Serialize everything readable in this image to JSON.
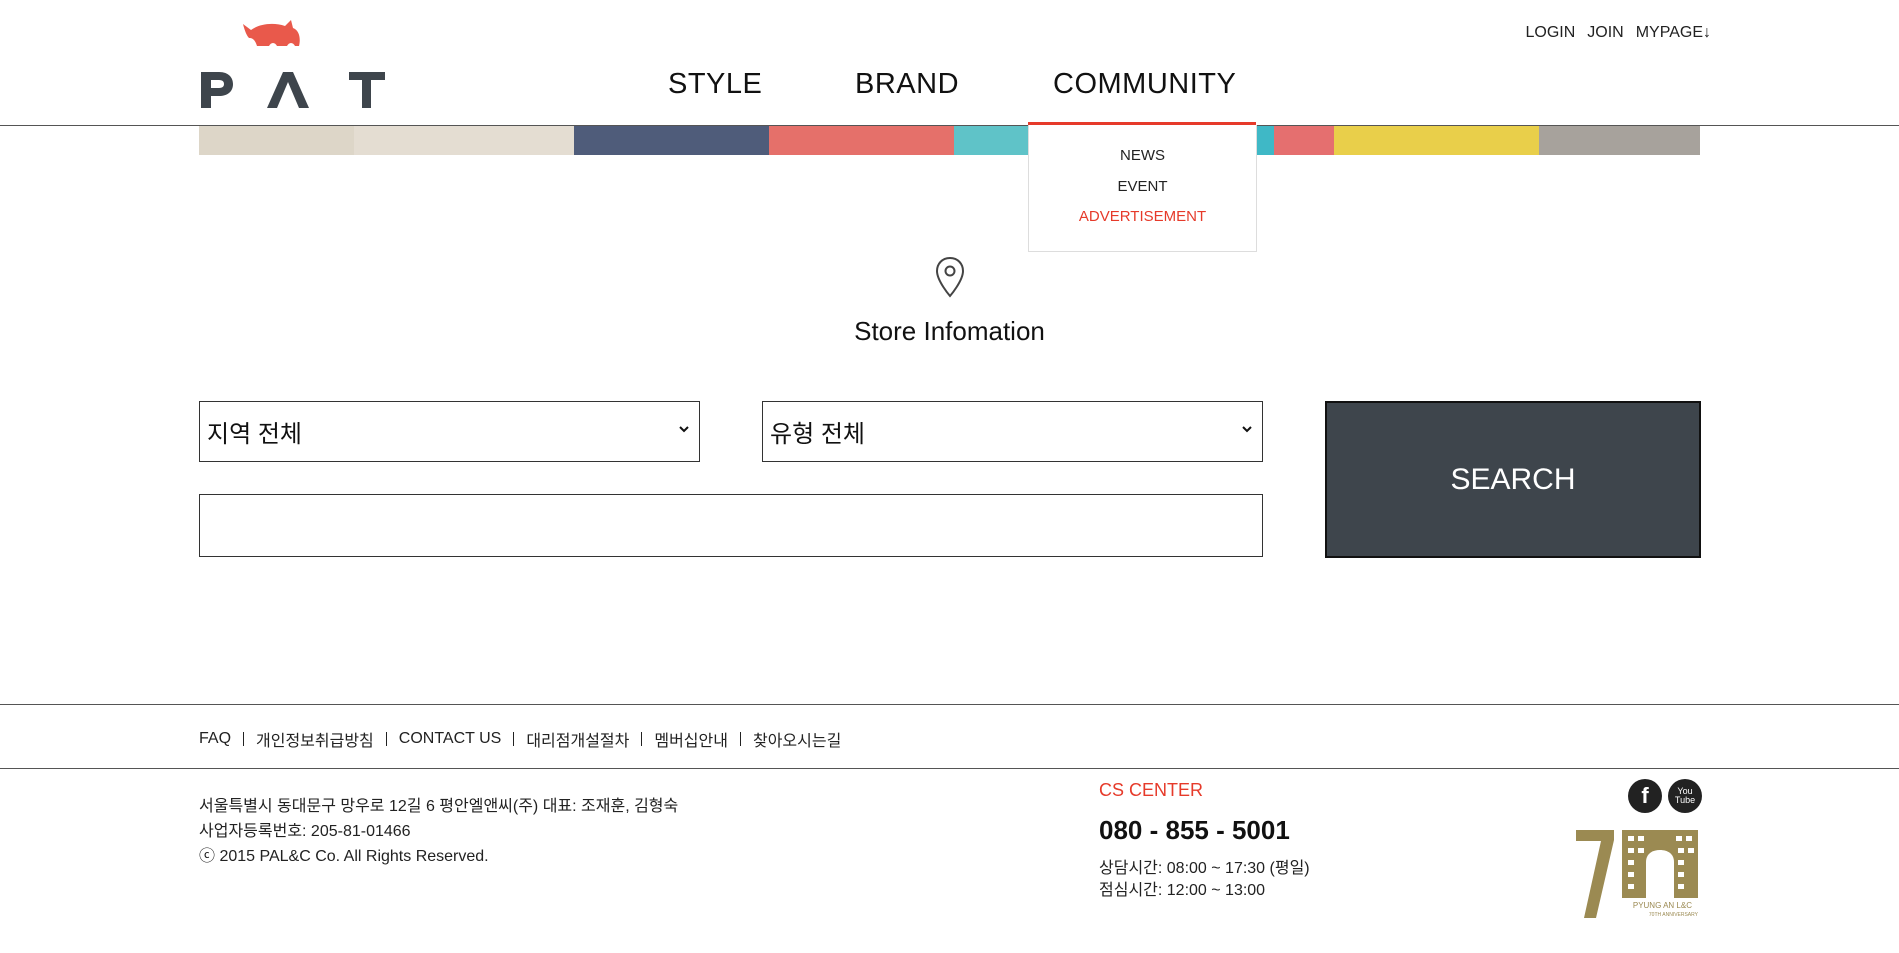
{
  "brand": {
    "name": "PAT",
    "accent_color": "#e63a2a",
    "dark_color": "#3e454c"
  },
  "header": {
    "util_links": [
      "LOGIN",
      "JOIN",
      "MYPAGE↓"
    ],
    "nav": {
      "style": "STYLE",
      "brand": "BRAND",
      "community": "COMMUNITY"
    },
    "community_menu": {
      "news": "NEWS",
      "event": "EVENT",
      "advertisement": "ADVERTISEMENT"
    }
  },
  "main": {
    "icon": "location-pin-icon",
    "title": "Store Infomation",
    "region_select": {
      "selected": "지역 전체"
    },
    "type_select": {
      "selected": "유형 전체"
    },
    "keyword_input": {
      "value": ""
    },
    "search_label": "SEARCH"
  },
  "footer": {
    "links": [
      "FAQ",
      "개인정보취급방침",
      "CONTACT US",
      "대리점개설절차",
      "멤버십안내",
      "찾아오시는길"
    ],
    "address_line1": "서울특별시 동대문구 망우로 12길 6 평안엘앤씨(주) 대표: 조재훈, 김형숙",
    "address_line2": "사업자등록번호: 205-81-01466",
    "copyright": "ⓒ 2015 PAL&C Co. All Rights Reserved.",
    "cs_title": "CS CENTER",
    "cs_phone": "080 - 855 - 5001",
    "cs_hours1": "상담시간: 08:00 ~ 17:30 (평일)",
    "cs_hours2": "점심시간: 12:00 ~ 13:00",
    "social": [
      "facebook-icon",
      "youtube-icon"
    ],
    "youtube_text": [
      "You",
      "Tube"
    ],
    "anniversary_logo": {
      "number": "70",
      "line1": "PYUNG AN L&C",
      "line2": "70TH ANNIVERSARY",
      "color": "#9b8a52"
    }
  }
}
